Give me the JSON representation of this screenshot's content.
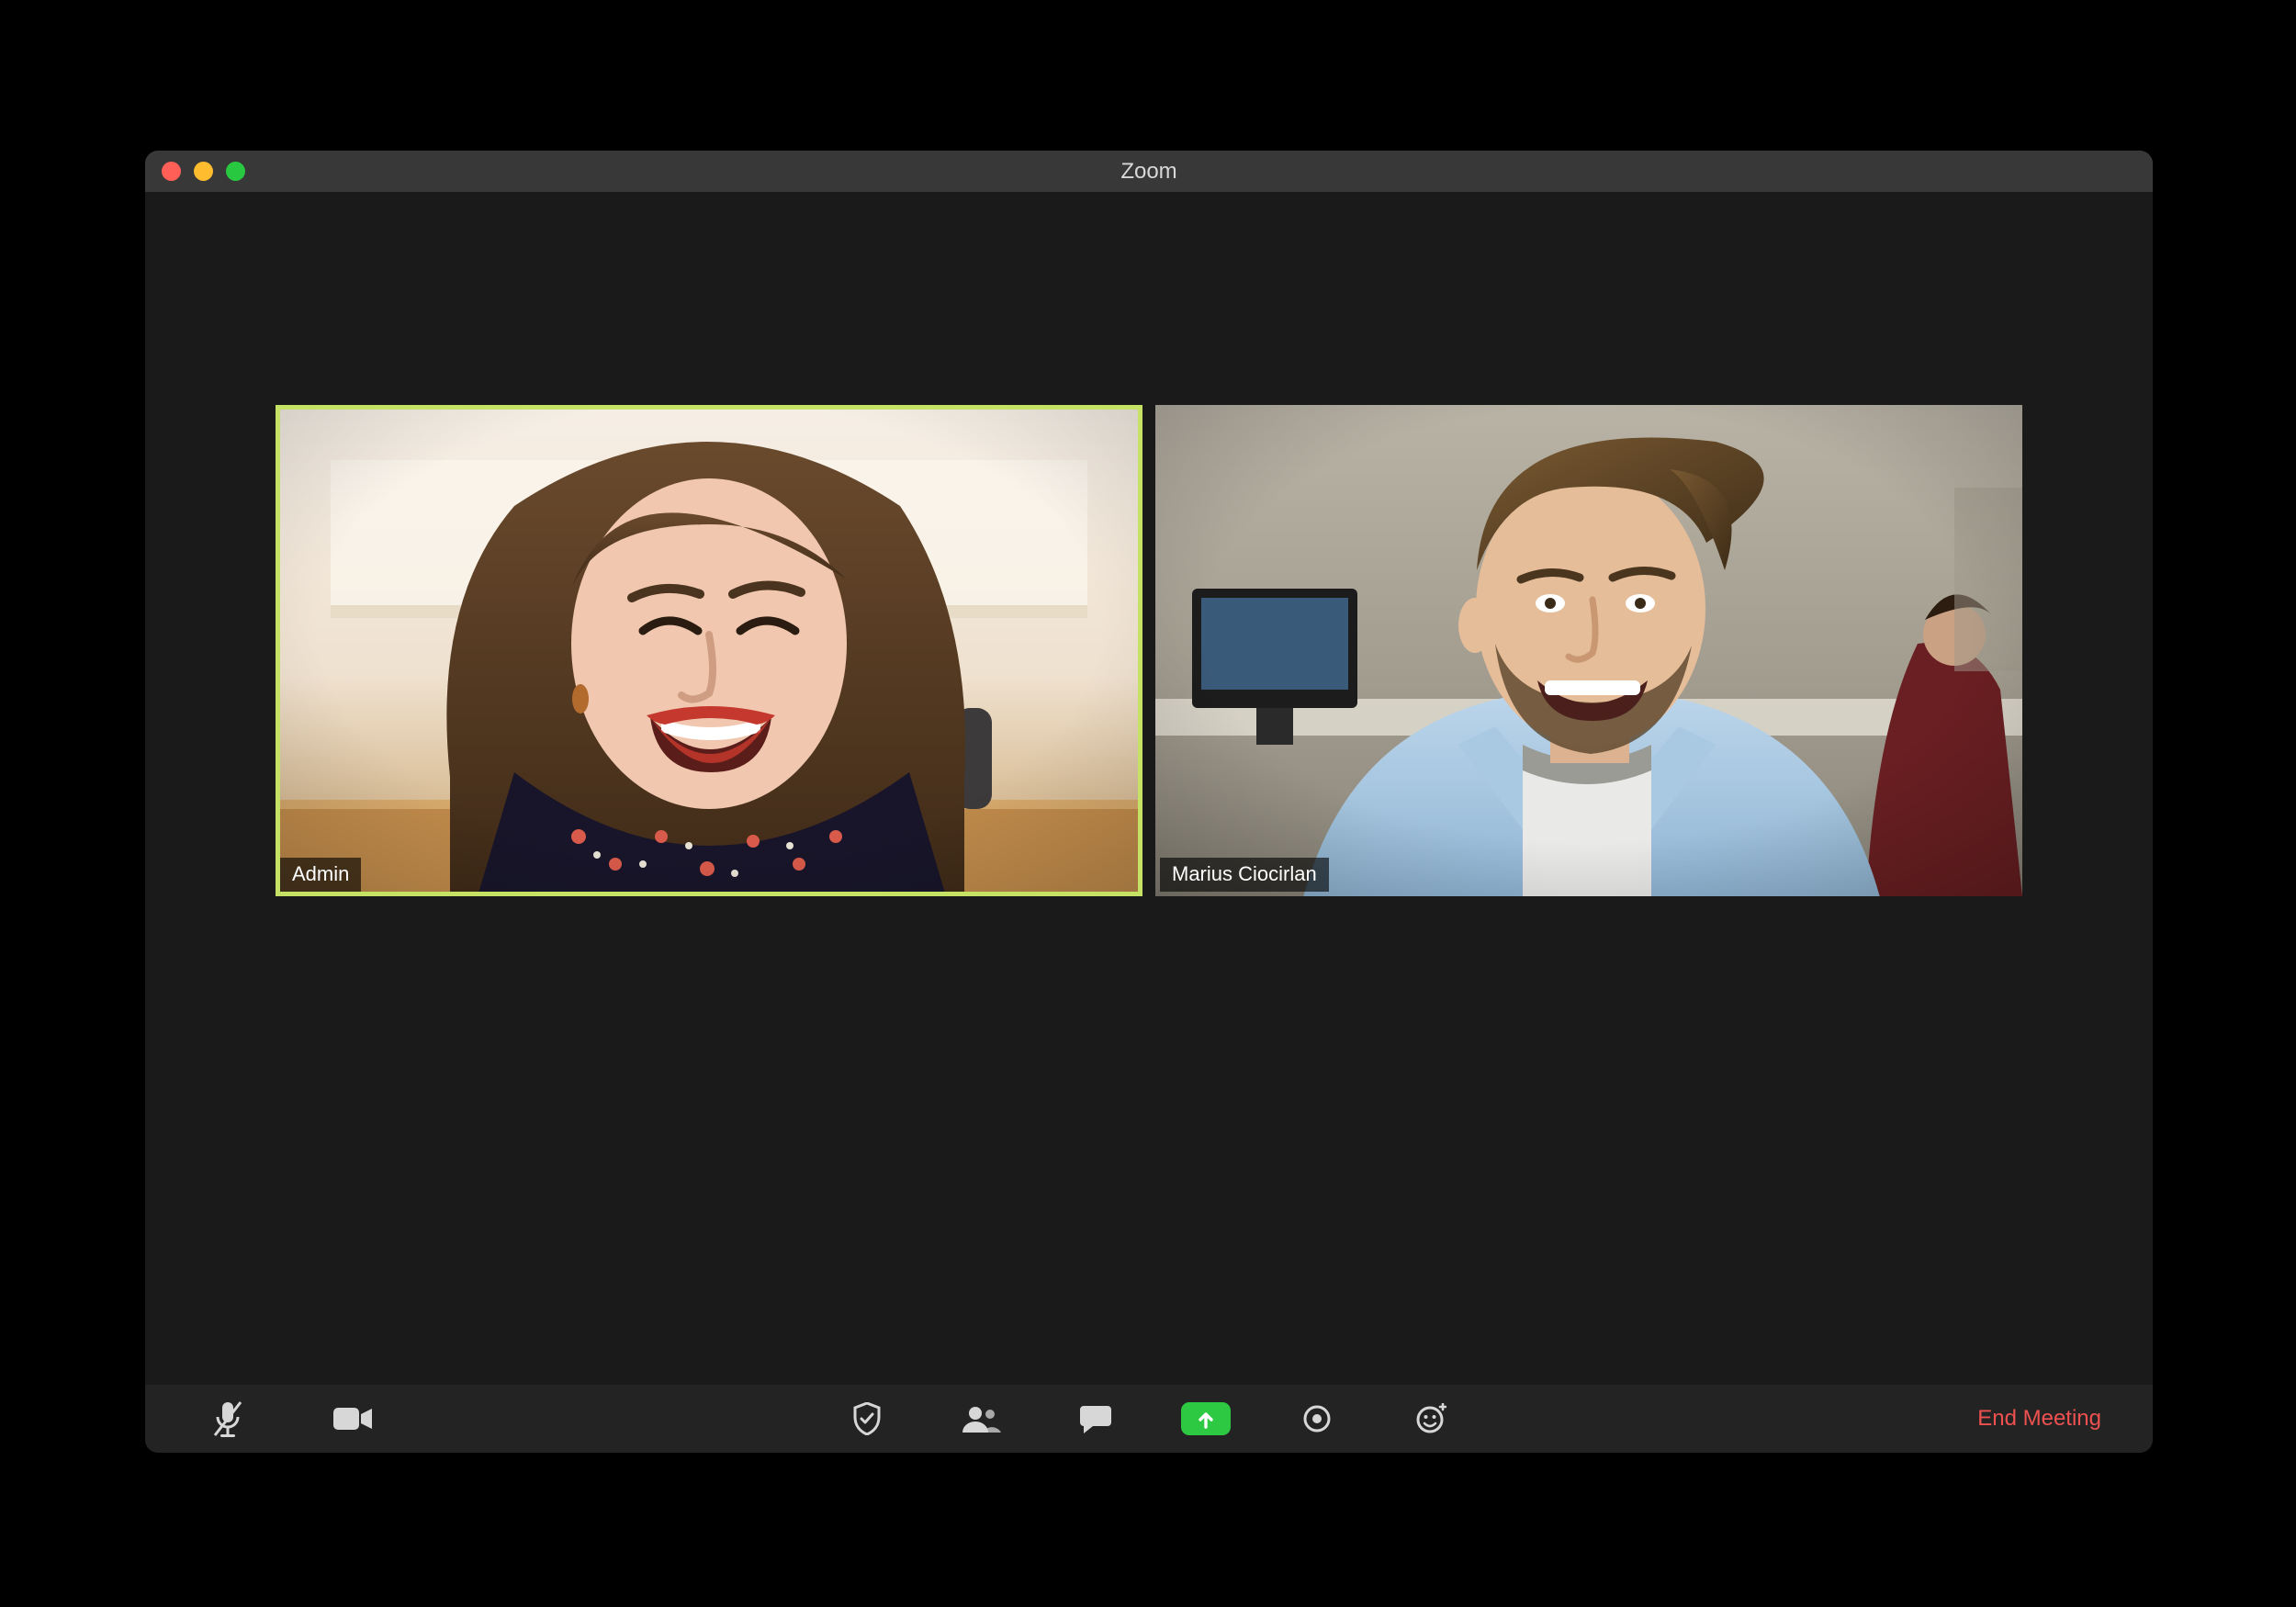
{
  "window": {
    "title": "Zoom"
  },
  "participants": [
    {
      "name": "Admin",
      "active": true
    },
    {
      "name": "Marius Ciocirlan",
      "active": false
    }
  ],
  "toolbar": {
    "end_label": "End Meeting",
    "icons": {
      "mic": "microphone-muted-icon",
      "video": "video-camera-icon",
      "security": "shield-icon",
      "participants": "participants-icon",
      "chat": "chat-bubble-icon",
      "share": "share-screen-icon",
      "record": "record-icon",
      "reactions": "reactions-smiley-icon"
    }
  },
  "colors": {
    "active_border": "#c5e264",
    "share_green": "#2dc942",
    "end_red": "#ee5150"
  }
}
